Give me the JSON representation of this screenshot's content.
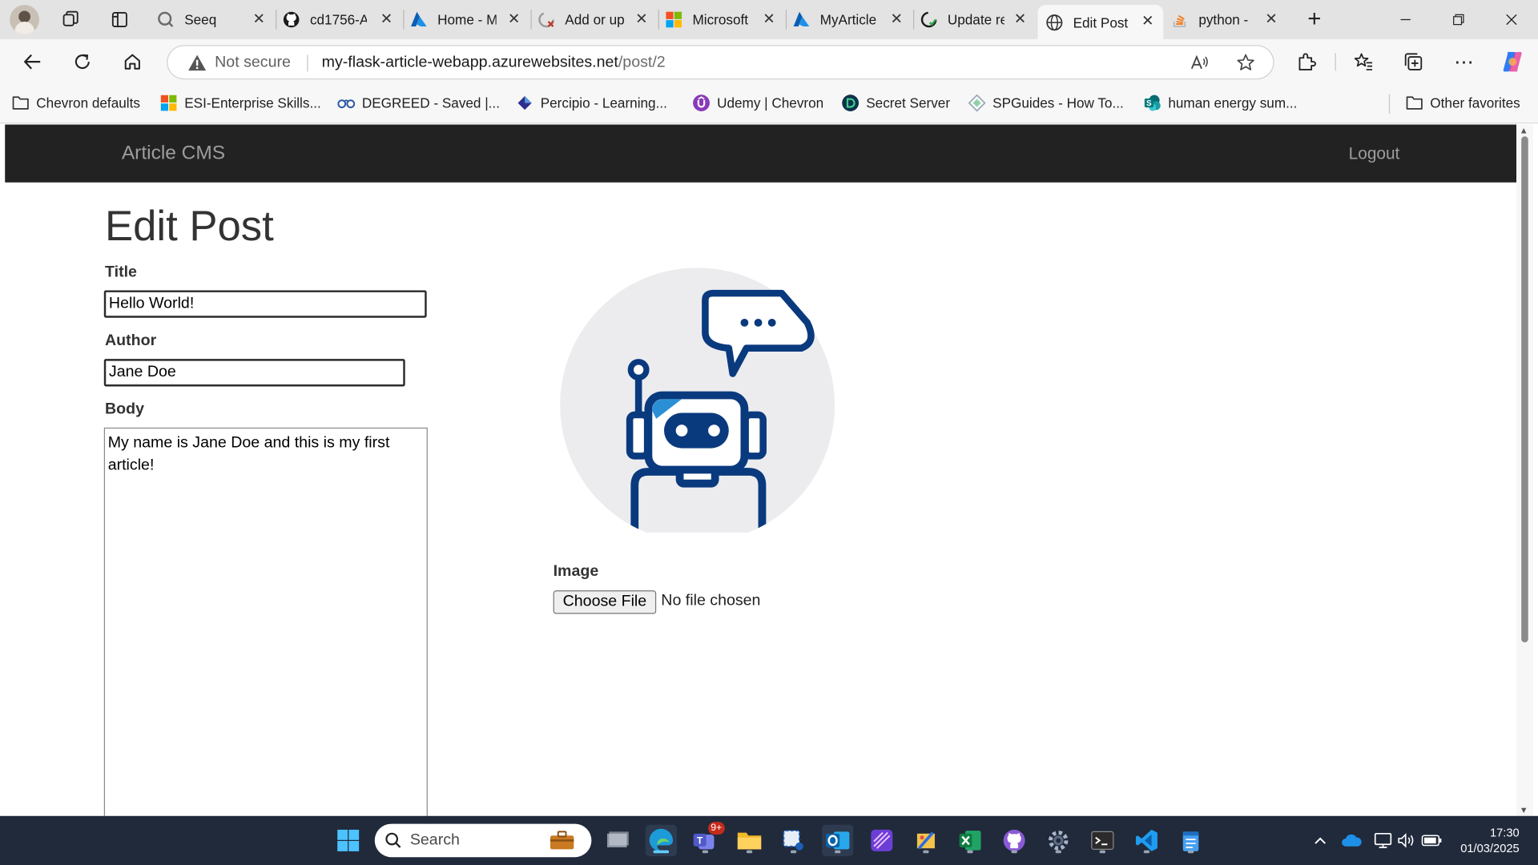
{
  "browser": {
    "tabs": [
      {
        "title": "Seeq",
        "icon": "seeq-icon"
      },
      {
        "title": "cd1756-A",
        "icon": "github-icon"
      },
      {
        "title": "Home - M",
        "icon": "azure-icon"
      },
      {
        "title": "Add or up",
        "icon": "github-loading-icon"
      },
      {
        "title": "Microsoft",
        "icon": "microsoft-icon"
      },
      {
        "title": "MyArticle",
        "icon": "azure-icon"
      },
      {
        "title": "Update re",
        "icon": "github-icon"
      },
      {
        "title": "Edit Post",
        "icon": "globe-icon",
        "active": true
      },
      {
        "title": "python -",
        "icon": "stackoverflow-icon"
      }
    ],
    "security_label": "Not secure",
    "url_host": "my-flask-article-webapp.azurewebsites.net",
    "url_path": "/post/2",
    "bookmarks": [
      {
        "label": "Chevron defaults",
        "icon": "folder-icon"
      },
      {
        "label": "ESI-Enterprise Skills...",
        "icon": "microsoft-icon"
      },
      {
        "label": "DEGREED - Saved |...",
        "icon": "degreed-icon"
      },
      {
        "label": "Percipio - Learning...",
        "icon": "percipio-icon"
      },
      {
        "label": "Udemy | Chevron",
        "icon": "udemy-icon"
      },
      {
        "label": "Secret Server",
        "icon": "secret-server-icon"
      },
      {
        "label": "SPGuides - How To...",
        "icon": "spguides-icon"
      },
      {
        "label": "human energy sum...",
        "icon": "sharepoint-icon"
      }
    ],
    "other_favorites": "Other favorites"
  },
  "site": {
    "brand": "Article CMS",
    "logout": "Logout"
  },
  "form": {
    "heading": "Edit Post",
    "title_label": "Title",
    "title_value": "Hello World!",
    "author_label": "Author",
    "author_value": "Jane Doe",
    "body_label": "Body",
    "body_value": "My name is Jane Doe and this is my first article!",
    "image_label": "Image",
    "file_button": "Choose File",
    "file_status": "No file chosen"
  },
  "taskbar": {
    "search_label": "Search",
    "teams_badge": "9+",
    "time": "17:30",
    "date": "01/03/2025"
  },
  "colors": {
    "navbar_bg": "#222222",
    "navbar_text": "#9d9d9d",
    "robot_blue": "#0a3a7e",
    "robot_accent": "#2b8fd6",
    "taskbar_bg": "#202a3b"
  }
}
